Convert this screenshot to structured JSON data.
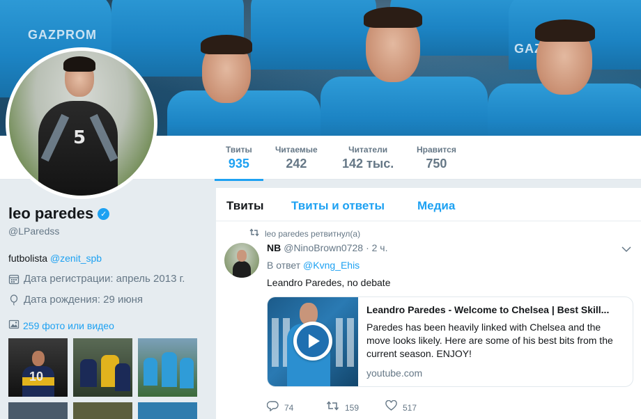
{
  "banner": {
    "sponsor_left": "GAZPROM",
    "sponsor_right": "GAZPROM"
  },
  "stats": [
    {
      "label": "Твиты",
      "value": "935",
      "active": true
    },
    {
      "label": "Читаемые",
      "value": "242",
      "active": false
    },
    {
      "label": "Читатели",
      "value": "142 тыс.",
      "active": false
    },
    {
      "label": "Нравится",
      "value": "750",
      "active": false
    }
  ],
  "avatar": {
    "shirt_number": "5"
  },
  "profile": {
    "name": "leo paredes",
    "verified_mark": "✓",
    "handle": "@LParedss",
    "bio_text": "futbolista",
    "bio_link": "@zenit_spb",
    "joined": "Дата регистрации: апрель 2013 г.",
    "birthday": "Дата рождения: 29 июня",
    "photos_link": "259 фото или видео"
  },
  "thumbs": [
    {
      "caption": "10"
    }
  ],
  "tabs": [
    {
      "label": "Твиты",
      "active": true
    },
    {
      "label": "Твиты и ответы",
      "active": false
    },
    {
      "label": "Медиа",
      "active": false
    }
  ],
  "tweet": {
    "retweet_text": "leo paredes ретвитнул(а)",
    "name": "NB",
    "handle": "@NinoBrown0728",
    "time": "· 2 ч.",
    "reply_prefix": "В ответ",
    "reply_handle": "@Kvng_Ehis",
    "text": "Leandro Paredes, no debate",
    "card": {
      "title": "Leandro Paredes - Welcome to Chelsea | Best Skill...",
      "description": "Paredes has been heavily linked with Chelsea and the move looks likely. Here are some of his best bits from the current season. ENJOY!",
      "domain": "youtube.com"
    },
    "actions": {
      "replies": "74",
      "retweets": "159",
      "likes": "517"
    }
  },
  "icons": {
    "retweet": "retweet-icon",
    "chevron": "chevron-down-icon",
    "calendar": "calendar-icon",
    "balloon": "birthday-balloon-icon",
    "photo": "photo-icon",
    "reply": "reply-icon",
    "like": "heart-icon",
    "play": "play-icon"
  },
  "colors": {
    "accent": "#1da1f2",
    "muted": "#657786",
    "background": "#e6ecf0"
  }
}
